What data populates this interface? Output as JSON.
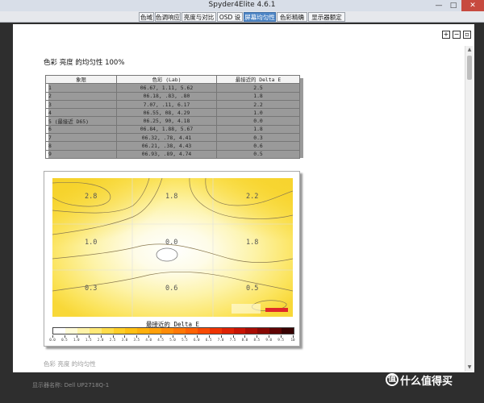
{
  "window": {
    "title": "Spyder4Elite 4.6.1",
    "controls": {
      "minimize": "—",
      "maximize": "□",
      "close": "✕"
    }
  },
  "tabs": [
    {
      "label": "色域"
    },
    {
      "label": "色调响应"
    },
    {
      "label": "亮度与对比度"
    },
    {
      "label": "OSD 设置"
    },
    {
      "label": "屏幕均匀性"
    },
    {
      "label": "色彩精确度"
    },
    {
      "label": "显示器额定值"
    }
  ],
  "active_tab": "屏幕均匀性",
  "zoom_buttons": [
    {
      "icon": "zoom-in-icon",
      "glyph": "+"
    },
    {
      "icon": "zoom-out-icon",
      "glyph": "−"
    },
    {
      "icon": "zoom-fit-icon",
      "glyph": "▫"
    }
  ],
  "report": {
    "heading": "色彩 亮度 的均匀性 100%",
    "table": {
      "headers": [
        "象限",
        "色彩 (Lab)",
        "最接近的 Delta E"
      ],
      "rows": [
        [
          "1",
          "06.67,    1.11,    5.62",
          "2.5"
        ],
        [
          "2",
          "06.18,    .83,    .80",
          "1.8"
        ],
        [
          "3",
          "7.07,    .11,    6.17",
          "2.2"
        ],
        [
          "4",
          "06.55,    08,    4.29",
          "1.0"
        ],
        [
          "5 (最接近 D65)",
          "06.25,    90,    4.18",
          "0.0"
        ],
        [
          "6",
          "06.84,    1.88,    5.67",
          "1.8"
        ],
        [
          "7",
          "06.32,    .78,    4.41",
          "0.3"
        ],
        [
          "8",
          "06.21,    .38,    4.43",
          "0.6"
        ],
        [
          "9",
          "06.93,    .89,    4.74",
          "0.5"
        ]
      ]
    },
    "map": {
      "values": [
        {
          "label": "2.8"
        },
        {
          "label": "1.8"
        },
        {
          "label": "2.2"
        },
        {
          "label": "1.0"
        },
        {
          "label": "0.0"
        },
        {
          "label": "1.8"
        },
        {
          "label": "0.3"
        },
        {
          "label": "0.6"
        },
        {
          "label": "0.5"
        }
      ],
      "legend_title": "最接近的 Delta E",
      "legend_ticks": [
        "0.0",
        "0.5",
        "1.0",
        "1.5",
        "2.0",
        "2.5",
        "3.0",
        "3.5",
        "4.0",
        "4.5",
        "5.0",
        "5.5",
        "6.0",
        "6.5",
        "7.0",
        "7.5",
        "8.0",
        "8.5",
        "9.0",
        "9.5",
        "10"
      ],
      "legend_colors": [
        "#ffffff",
        "#fffbd8",
        "#fff3a8",
        "#ffe978",
        "#ffdc4a",
        "#ffce28",
        "#ffc014",
        "#ffb00c",
        "#ffa00a",
        "#ff8c08",
        "#ff7806",
        "#ff6204",
        "#f84a04",
        "#ee3404",
        "#de2204",
        "#c81404",
        "#a80c04",
        "#860804",
        "#600404",
        "#380202"
      ]
    },
    "partial_text": "色彩 亮度 的均匀性"
  },
  "status": {
    "monitor": "显示器名称: Dell UP2718Q-1"
  },
  "watermark": {
    "text": "什么值得买",
    "icon_glyph": "值"
  }
}
